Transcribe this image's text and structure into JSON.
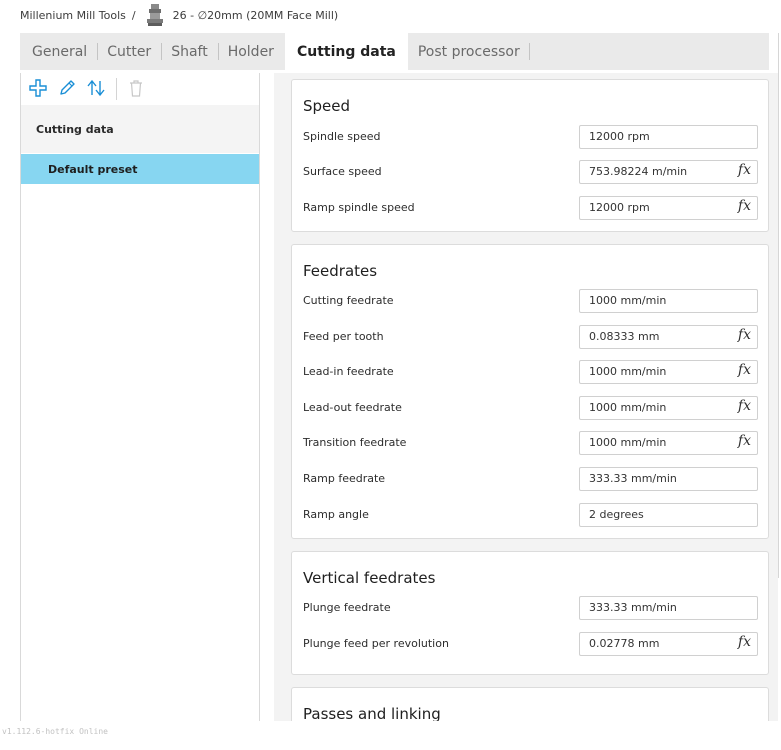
{
  "breadcrumb": {
    "library": "Millenium Mill Tools",
    "separator": "/",
    "tool_name": "26 - ∅20mm (20MM Face Mill)"
  },
  "tabs": [
    {
      "label": "General",
      "active": false
    },
    {
      "label": "Cutter",
      "active": false
    },
    {
      "label": "Shaft",
      "active": false
    },
    {
      "label": "Holder",
      "active": false
    },
    {
      "label": "Cutting data",
      "active": true
    },
    {
      "label": "Post processor",
      "active": false
    }
  ],
  "toolbar": {
    "add_icon": "plus-icon",
    "edit_icon": "pencil-icon",
    "reorder_icon": "sort-arrows-icon",
    "delete_icon": "trash-icon",
    "accent_color": "#1a8fd6"
  },
  "tree": {
    "header": "Cutting data",
    "selected_item": "Default preset",
    "selected_color": "#87d6f1"
  },
  "sections": {
    "speed": {
      "title": "Speed",
      "rows": [
        {
          "label": "Spindle speed",
          "value": "12000 rpm",
          "fx": ""
        },
        {
          "label": "Surface speed",
          "value": "753.98224 m/min",
          "fx": "fx"
        },
        {
          "label": "Ramp spindle speed",
          "value": "12000 rpm",
          "fx": "fx"
        }
      ]
    },
    "feedrates": {
      "title": "Feedrates",
      "rows": [
        {
          "label": "Cutting feedrate",
          "value": "1000 mm/min",
          "fx": ""
        },
        {
          "label": "Feed per tooth",
          "value": "0.08333 mm",
          "fx": "fx"
        },
        {
          "label": "Lead-in feedrate",
          "value": "1000 mm/min",
          "fx": "fx"
        },
        {
          "label": "Lead-out feedrate",
          "value": "1000 mm/min",
          "fx": "fx"
        },
        {
          "label": "Transition feedrate",
          "value": "1000 mm/min",
          "fx": "fx"
        },
        {
          "label": "Ramp feedrate",
          "value": "333.33 mm/min",
          "fx": ""
        },
        {
          "label": "Ramp angle",
          "value": "2 degrees",
          "fx": ""
        }
      ]
    },
    "vertical": {
      "title": "Vertical feedrates",
      "rows": [
        {
          "label": "Plunge feedrate",
          "value": "333.33 mm/min",
          "fx": ""
        },
        {
          "label": "Plunge feed per revolution",
          "value": "0.02778 mm",
          "fx": "fx"
        }
      ]
    },
    "passes": {
      "title": "Passes and linking"
    }
  },
  "footer": {
    "version": "v1.112.6-hotfix Online"
  }
}
